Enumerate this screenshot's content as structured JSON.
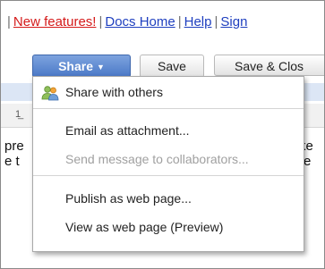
{
  "header_links": {
    "new_features": "New features!",
    "docs_home": "Docs Home",
    "help": "Help",
    "sign": "Sign",
    "separator": "|"
  },
  "toolbar": {
    "share_label": "Share",
    "share_caret": "▼",
    "save_label": "Save",
    "save_close_label": "Save & Clos"
  },
  "document": {
    "toolbar_glyph": "1̲",
    "left_fragments": [
      "pre",
      "e t"
    ],
    "right_fragments": [
      "ke",
      "re"
    ]
  },
  "share_menu": {
    "items": [
      {
        "label": "Share with others",
        "icon": "people-icon",
        "enabled": true
      },
      {
        "label": "Email as attachment...",
        "enabled": true
      },
      {
        "label": "Send message to collaborators...",
        "enabled": false
      },
      {
        "label": "Publish as web page...",
        "enabled": true
      },
      {
        "label": "View as web page (Preview)",
        "enabled": true
      }
    ]
  },
  "colors": {
    "new_features_link": "#d51a1a",
    "link": "#1f3fbf",
    "share_button": "#4a78c7",
    "disabled_text": "#a0a0a0"
  }
}
